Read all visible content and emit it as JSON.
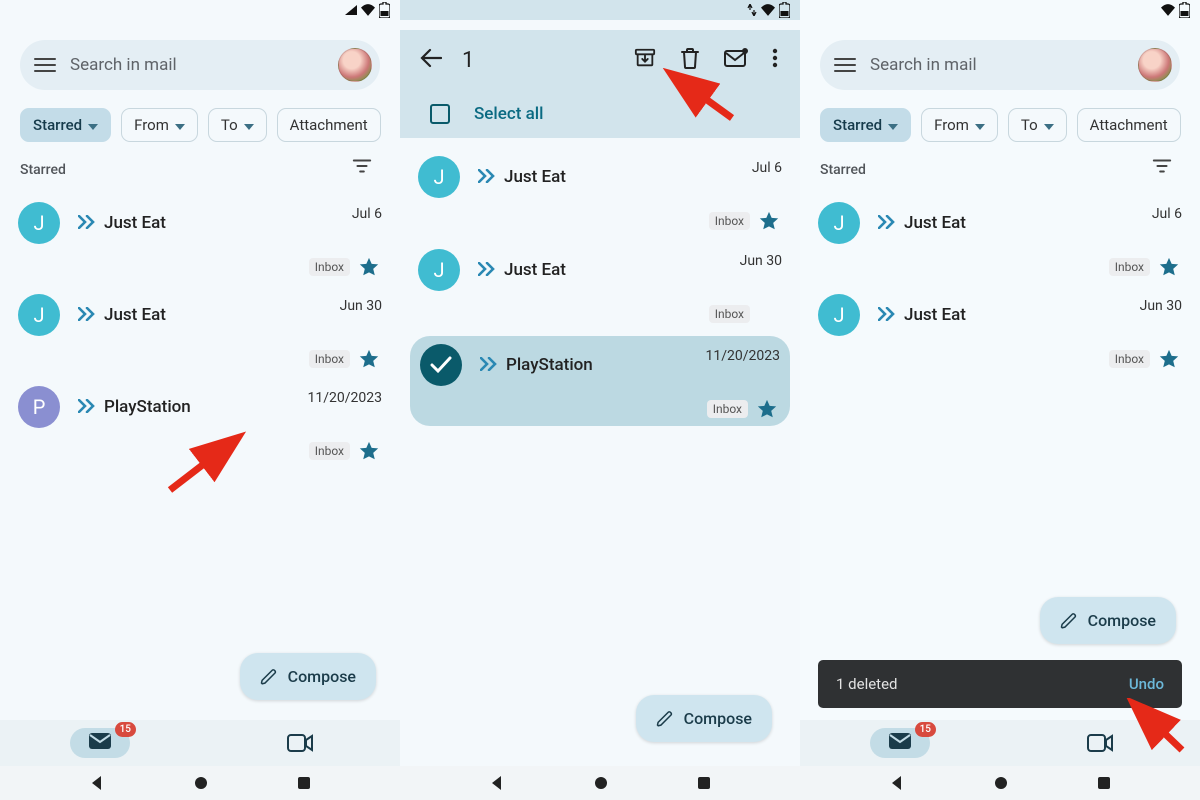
{
  "status": {
    "up": "▲",
    "down": "▼"
  },
  "search": {
    "placeholder": "Search in mail"
  },
  "chips": {
    "starred": "Starred",
    "from": "From",
    "to": "To",
    "attachment": "Attachment"
  },
  "section": {
    "label": "Starred"
  },
  "emails": {
    "je1": {
      "avatar": "J",
      "sender": "Just Eat",
      "date": "Jul 6",
      "tag": "Inbox"
    },
    "je2": {
      "avatar": "J",
      "sender": "Just Eat",
      "date": "Jun 30",
      "tag": "Inbox"
    },
    "ps": {
      "avatar": "P",
      "sender": "PlayStation",
      "date": "11/20/2023",
      "tag": "Inbox"
    }
  },
  "selection": {
    "count": "1",
    "selectall": "Select all"
  },
  "compose": {
    "label": "Compose"
  },
  "bottombar": {
    "badge": "15"
  },
  "snackbar": {
    "text": "1 deleted",
    "action": "Undo"
  }
}
